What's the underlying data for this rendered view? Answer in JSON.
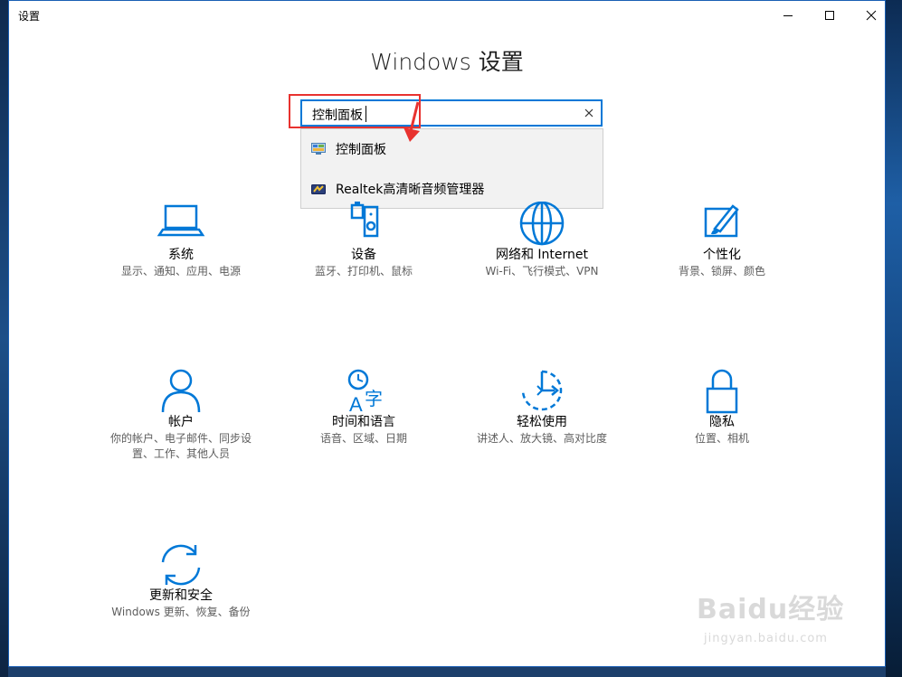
{
  "window": {
    "title": "设置"
  },
  "heading": "Windows 设置",
  "search": {
    "value": "控制面板"
  },
  "suggestions": [
    {
      "label": "控制面板",
      "icon": "control-panel-icon"
    },
    {
      "label": "Realtek高清晰音频管理器",
      "icon": "realtek-audio-icon"
    }
  ],
  "tiles": [
    {
      "name": "系统",
      "desc": "显示、通知、应用、电源",
      "icon": "laptop-icon"
    },
    {
      "name": "设备",
      "desc": "蓝牙、打印机、鼠标",
      "icon": "devices-icon"
    },
    {
      "name": "网络和 Internet",
      "desc": "Wi-Fi、飞行模式、VPN",
      "icon": "globe-icon"
    },
    {
      "name": "个性化",
      "desc": "背景、锁屏、颜色",
      "icon": "paintbrush-icon"
    },
    {
      "name": "帐户",
      "desc": "你的帐户、电子邮件、同步设置、工作、其他人员",
      "icon": "person-icon"
    },
    {
      "name": "时间和语言",
      "desc": "语音、区域、日期",
      "icon": "time-language-icon"
    },
    {
      "name": "轻松使用",
      "desc": "讲述人、放大镜、高对比度",
      "icon": "ease-of-access-icon"
    },
    {
      "name": "隐私",
      "desc": "位置、相机",
      "icon": "lock-icon"
    },
    {
      "name": "更新和安全",
      "desc": "Windows 更新、恢复、备份",
      "icon": "sync-icon"
    }
  ],
  "watermark": {
    "brand": "Baidu经验",
    "url": "jingyan.baidu.com"
  },
  "colors": {
    "accent": "#0078d7",
    "highlight": "#e8322f"
  }
}
